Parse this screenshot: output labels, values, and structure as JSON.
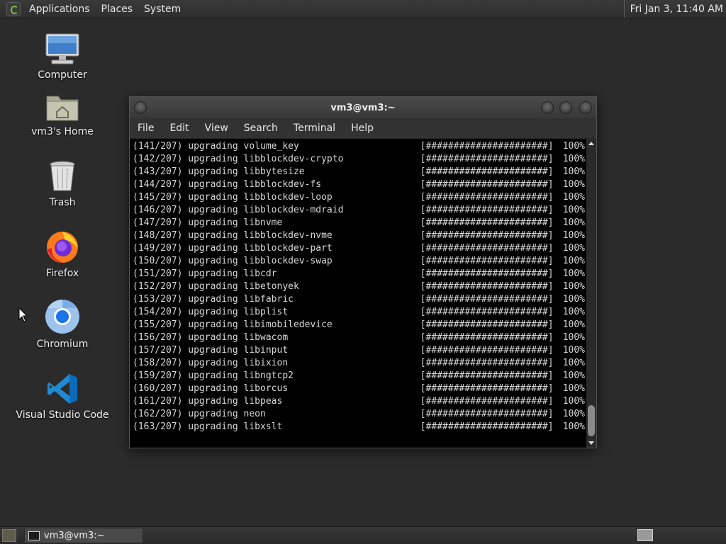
{
  "top_panel": {
    "menus": [
      "Applications",
      "Places",
      "System"
    ],
    "clock": "Fri Jan  3, 11:40 AM"
  },
  "desktop_icons": [
    {
      "label": "Computer",
      "icon": "computer-icon"
    },
    {
      "label": "vm3's Home",
      "icon": "home-folder-icon"
    },
    {
      "label": "Trash",
      "icon": "trash-icon"
    },
    {
      "label": "Firefox",
      "icon": "firefox-icon"
    },
    {
      "label": "Chromium",
      "icon": "chromium-icon"
    },
    {
      "label": "Visual Studio Code",
      "icon": "vscode-icon"
    }
  ],
  "terminal": {
    "title": "vm3@vm3:~",
    "menus": [
      "File",
      "Edit",
      "View",
      "Search",
      "Terminal",
      "Help"
    ],
    "lines": [
      {
        "text": "(141/207) upgrading volume_key",
        "bar": "[######################]",
        "pct": "100%"
      },
      {
        "text": "(142/207) upgrading libblockdev-crypto",
        "bar": "[######################]",
        "pct": "100%"
      },
      {
        "text": "(143/207) upgrading libbytesize",
        "bar": "[######################]",
        "pct": "100%"
      },
      {
        "text": "(144/207) upgrading libblockdev-fs",
        "bar": "[######################]",
        "pct": "100%"
      },
      {
        "text": "(145/207) upgrading libblockdev-loop",
        "bar": "[######################]",
        "pct": "100%"
      },
      {
        "text": "(146/207) upgrading libblockdev-mdraid",
        "bar": "[######################]",
        "pct": "100%"
      },
      {
        "text": "(147/207) upgrading libnvme",
        "bar": "[######################]",
        "pct": "100%"
      },
      {
        "text": "(148/207) upgrading libblockdev-nvme",
        "bar": "[######################]",
        "pct": "100%"
      },
      {
        "text": "(149/207) upgrading libblockdev-part",
        "bar": "[######################]",
        "pct": "100%"
      },
      {
        "text": "(150/207) upgrading libblockdev-swap",
        "bar": "[######################]",
        "pct": "100%"
      },
      {
        "text": "(151/207) upgrading libcdr",
        "bar": "[######################]",
        "pct": "100%"
      },
      {
        "text": "(152/207) upgrading libetonyek",
        "bar": "[######################]",
        "pct": "100%"
      },
      {
        "text": "(153/207) upgrading libfabric",
        "bar": "[######################]",
        "pct": "100%"
      },
      {
        "text": "(154/207) upgrading libplist",
        "bar": "[######################]",
        "pct": "100%"
      },
      {
        "text": "(155/207) upgrading libimobiledevice",
        "bar": "[######################]",
        "pct": "100%"
      },
      {
        "text": "(156/207) upgrading libwacom",
        "bar": "[######################]",
        "pct": "100%"
      },
      {
        "text": "(157/207) upgrading libinput",
        "bar": "[######################]",
        "pct": "100%"
      },
      {
        "text": "(158/207) upgrading libixion",
        "bar": "[######################]",
        "pct": "100%"
      },
      {
        "text": "(159/207) upgrading libngtcp2",
        "bar": "[######################]",
        "pct": "100%"
      },
      {
        "text": "(160/207) upgrading liborcus",
        "bar": "[######################]",
        "pct": "100%"
      },
      {
        "text": "(161/207) upgrading libpeas",
        "bar": "[######################]",
        "pct": "100%"
      },
      {
        "text": "(162/207) upgrading neon",
        "bar": "[######################]",
        "pct": "100%"
      },
      {
        "text": "(163/207) upgrading libxslt",
        "bar": "[######################]",
        "pct": "100%"
      }
    ]
  },
  "taskbar": {
    "task_label": "vm3@vm3:~"
  }
}
